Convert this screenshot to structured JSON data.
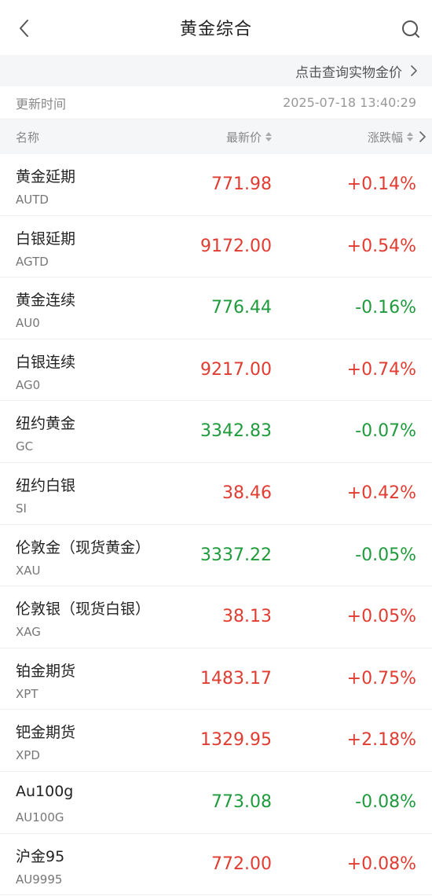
{
  "header": {
    "title": "黄金综合",
    "back_icon": "chevron-left-icon",
    "search_icon": "search-icon"
  },
  "physical_link": {
    "label": "点击查询实物金价"
  },
  "update": {
    "label": "更新时间",
    "time": "2025-07-18 13:40:29"
  },
  "table": {
    "col_name": "名称",
    "col_price": "最新价",
    "col_change": "涨跌幅",
    "up_color": "#e03c31",
    "down_color": "#1f9a3c"
  },
  "rows": [
    {
      "name": "黄金延期",
      "code": "AUTD",
      "price": "771.98",
      "change": "+0.14%",
      "dir": "up"
    },
    {
      "name": "白银延期",
      "code": "AGTD",
      "price": "9172.00",
      "change": "+0.54%",
      "dir": "up"
    },
    {
      "name": "黄金连续",
      "code": "AU0",
      "price": "776.44",
      "change": "-0.16%",
      "dir": "down"
    },
    {
      "name": "白银连续",
      "code": "AG0",
      "price": "9217.00",
      "change": "+0.74%",
      "dir": "up"
    },
    {
      "name": "纽约黄金",
      "code": "GC",
      "price": "3342.83",
      "change": "-0.07%",
      "dir": "down"
    },
    {
      "name": "纽约白银",
      "code": "SI",
      "price": "38.46",
      "change": "+0.42%",
      "dir": "up"
    },
    {
      "name": "伦敦金（现货黄金）",
      "code": "XAU",
      "price": "3337.22",
      "change": "-0.05%",
      "dir": "down"
    },
    {
      "name": "伦敦银（现货白银）",
      "code": "XAG",
      "price": "38.13",
      "change": "+0.05%",
      "dir": "up"
    },
    {
      "name": "铂金期货",
      "code": "XPT",
      "price": "1483.17",
      "change": "+0.75%",
      "dir": "up"
    },
    {
      "name": "钯金期货",
      "code": "XPD",
      "price": "1329.95",
      "change": "+2.18%",
      "dir": "up"
    },
    {
      "name": "Au100g",
      "code": "AU100G",
      "price": "773.08",
      "change": "-0.08%",
      "dir": "down"
    },
    {
      "name": "沪金95",
      "code": "AU9995",
      "price": "772.00",
      "change": "+0.08%",
      "dir": "up"
    }
  ]
}
